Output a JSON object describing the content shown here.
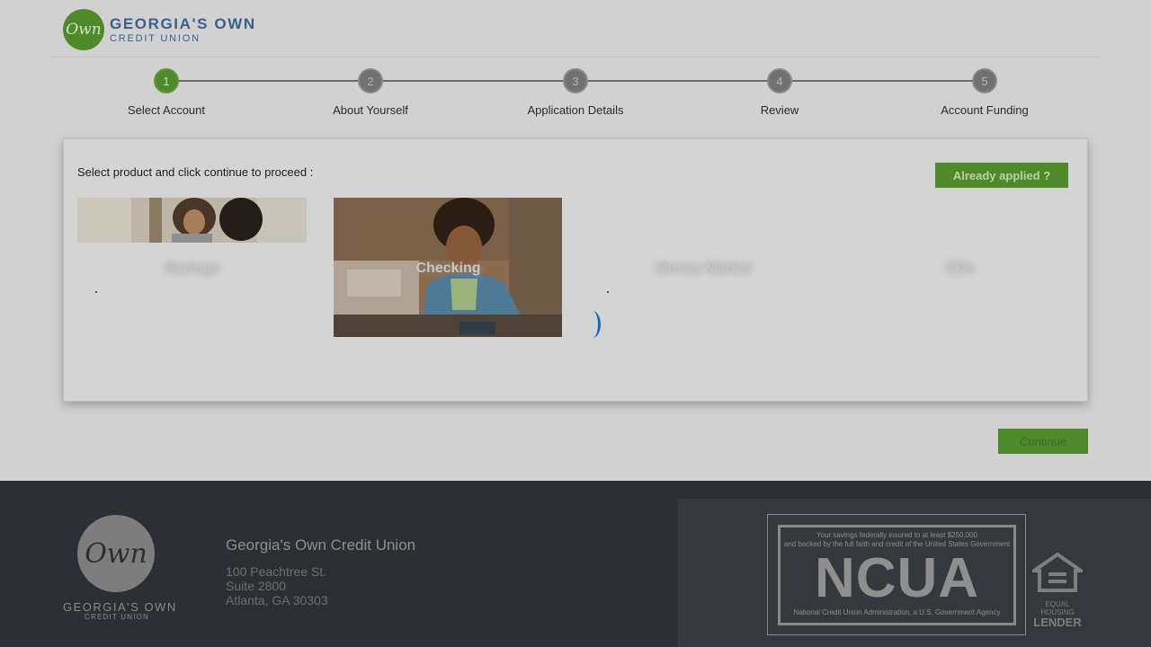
{
  "header": {
    "logo_mark": "Own",
    "logo_line1": "GEORGIA'S OWN",
    "logo_line2": "CREDIT UNION"
  },
  "stepper": {
    "active_step": 1,
    "steps": [
      {
        "num": "1",
        "label": "Select Account"
      },
      {
        "num": "2",
        "label": "About Yourself"
      },
      {
        "num": "3",
        "label": "Application Details"
      },
      {
        "num": "4",
        "label": "Review"
      },
      {
        "num": "5",
        "label": "Account Funding"
      }
    ]
  },
  "card": {
    "instruction": "Select product and click continue to proceed :",
    "already_applied_label": "Already applied ?",
    "products": [
      {
        "title": "Savings"
      },
      {
        "title": "Checking"
      },
      {
        "title": "Money Market"
      },
      {
        "title": "CDs"
      }
    ]
  },
  "continue_label": "Continue",
  "footer": {
    "logo_mark": "Own",
    "logo_line1": "GEORGIA'S OWN",
    "logo_line2": "CREDIT UNION",
    "org_name": "Georgia's Own Credit Union",
    "address_line1": "100 Peachtree St.",
    "address_line2": "Suite 2800",
    "address_line3": "Atlanta, GA 30303",
    "ncua_top1": "Your savings federally insured to at least $250,000",
    "ncua_top2": "and backed by the full faith and credit of the United States Government",
    "ncua_big": "NCUA",
    "ncua_bottom": "National Credit Union Administration, a U.S. Government Agency",
    "ehl_line1": "EQUAL HOUSING",
    "ehl_line2": "LENDER"
  },
  "colors": {
    "brand_green": "#4e8a2a",
    "brand_blue": "#3a5f8c",
    "overlay_bg": "#d1d1d1",
    "footer_bg": "#2c2f33",
    "spinner_blue": "#1466c4"
  }
}
